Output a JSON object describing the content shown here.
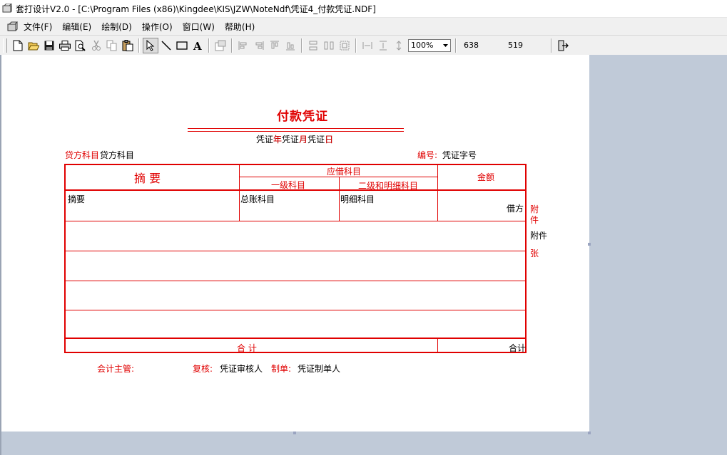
{
  "window": {
    "title": "套打设计V2.0 - [C:\\Program Files (x86)\\Kingdee\\KIS\\JZW\\NoteNdf\\凭证4_付款凭证.NDF]"
  },
  "menu": [
    {
      "label": "文件(F)"
    },
    {
      "label": "编辑(E)"
    },
    {
      "label": "绘制(D)"
    },
    {
      "label": "操作(O)"
    },
    {
      "label": "窗口(W)"
    },
    {
      "label": "帮助(H)"
    }
  ],
  "toolbar": {
    "zoom": "100%",
    "coord_x": "638",
    "coord_y": "519"
  },
  "voucher": {
    "title": "付款凭证",
    "date_year": "凭证年",
    "date_year_char": "年",
    "date_month": "凭证月",
    "date_month_char": "月",
    "date_day": "凭证日",
    "date_day_char": "日",
    "credit_account_label": "贷方科目",
    "credit_account_value": "贷方科目",
    "number_label": "编号:",
    "number_value": "凭证字号",
    "header_summary": "摘    要",
    "header_debit_account": "应借科目",
    "header_level1": "一级科目",
    "header_level2": "二级和明细科目",
    "header_amount": "金额",
    "row_summary": "摘要",
    "row_general_account": "总账科目",
    "row_detail_account": "明细科目",
    "row_debit": "借方",
    "total_label": "合    计",
    "total_value": "合计",
    "attach_label_1": "附",
    "attach_label_2": "件",
    "attach_value": "附件",
    "attach_unit": "张",
    "accountant_label": "会计主管:",
    "review_label": "复核:",
    "review_value": "凭证审核人",
    "maker_label": "制单:",
    "maker_value": "凭证制单人"
  }
}
